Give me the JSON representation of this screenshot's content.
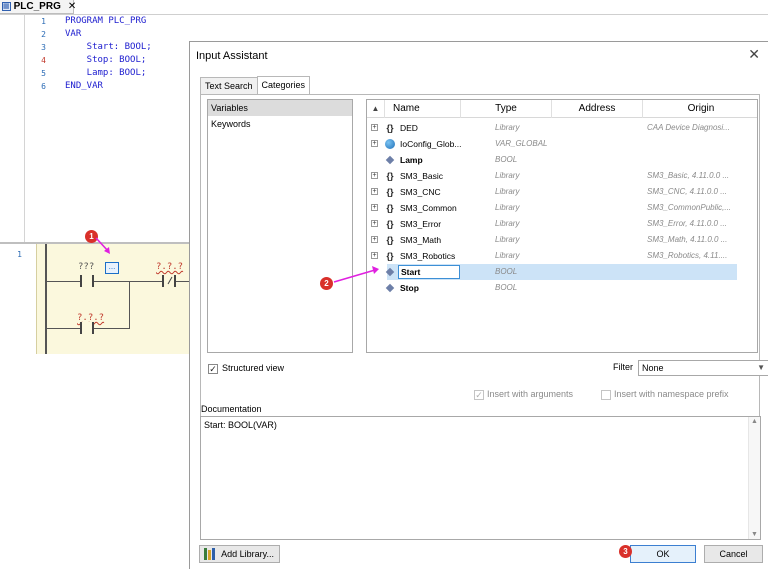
{
  "editor": {
    "tab_label": "PLC_PRG",
    "tab_close": "✕",
    "lines": [
      {
        "no": "1",
        "text": "PROGRAM PLC_PRG"
      },
      {
        "no": "2",
        "text": "VAR"
      },
      {
        "no": "3",
        "text": "    Start: BOOL;"
      },
      {
        "no": "4",
        "text": "    Stop: BOOL;"
      },
      {
        "no": "5",
        "text": "    Lamp: BOOL;"
      },
      {
        "no": "6",
        "text": "END_VAR"
      }
    ],
    "ladder": {
      "network_no": "1",
      "contact1_label": "???",
      "coil_label": "...",
      "contact2_label": "?.?.?",
      "contact3_label": "?.?.?"
    }
  },
  "annotations": {
    "step1": "1",
    "step2": "2",
    "step3": "3",
    "accent": "#d9302a",
    "arrow_color": "#e020e0"
  },
  "dialog": {
    "title": "Input Assistant",
    "close_icon": "✕",
    "tabs": [
      {
        "label": "Text Search",
        "active": false
      },
      {
        "label": "Categories",
        "active": true
      }
    ],
    "categories": [
      {
        "label": "Variables",
        "selected": true
      },
      {
        "label": "Keywords",
        "selected": false
      }
    ],
    "columns": {
      "name": "Name",
      "type": "Type",
      "address": "Address",
      "origin": "Origin"
    },
    "rows": [
      {
        "name": "DED",
        "type": "Library",
        "origin": "CAA Device Diagnosi...",
        "icon": "braces-icon"
      },
      {
        "name": "IoConfig_Glob...",
        "type": "VAR_GLOBAL",
        "origin": "",
        "icon": "globe-icon"
      },
      {
        "name": "Lamp",
        "type": "BOOL",
        "origin": "",
        "icon": "variable-icon"
      },
      {
        "name": "SM3_Basic",
        "type": "Library",
        "origin": "SM3_Basic, 4.11.0.0 ...",
        "icon": "braces-icon"
      },
      {
        "name": "SM3_CNC",
        "type": "Library",
        "origin": "SM3_CNC, 4.11.0.0 ...",
        "icon": "braces-icon"
      },
      {
        "name": "SM3_Common",
        "type": "Library",
        "origin": "SM3_CommonPublic,...",
        "icon": "braces-icon"
      },
      {
        "name": "SM3_Error",
        "type": "Library",
        "origin": "SM3_Error, 4.11.0.0 ...",
        "icon": "braces-icon"
      },
      {
        "name": "SM3_Math",
        "type": "Library",
        "origin": "SM3_Math, 4.11.0.0 ...",
        "icon": "braces-icon"
      },
      {
        "name": "SM3_Robotics",
        "type": "Library",
        "origin": "SM3_Robotics, 4.11....",
        "icon": "braces-icon"
      },
      {
        "name": "Start",
        "type": "BOOL",
        "origin": "",
        "icon": "variable-icon"
      },
      {
        "name": "Stop",
        "type": "BOOL",
        "origin": "",
        "icon": "variable-icon"
      }
    ],
    "structured_view_label": "Structured view",
    "filter_label": "Filter",
    "filter_value": "None",
    "insert_with_arguments": "Insert with arguments",
    "insert_with_namespace": "Insert with namespace prefix",
    "documentation_label": "Documentation",
    "documentation_text": "Start: BOOL(VAR)",
    "add_library": "Add Library...",
    "ok": "OK",
    "cancel": "Cancel"
  }
}
